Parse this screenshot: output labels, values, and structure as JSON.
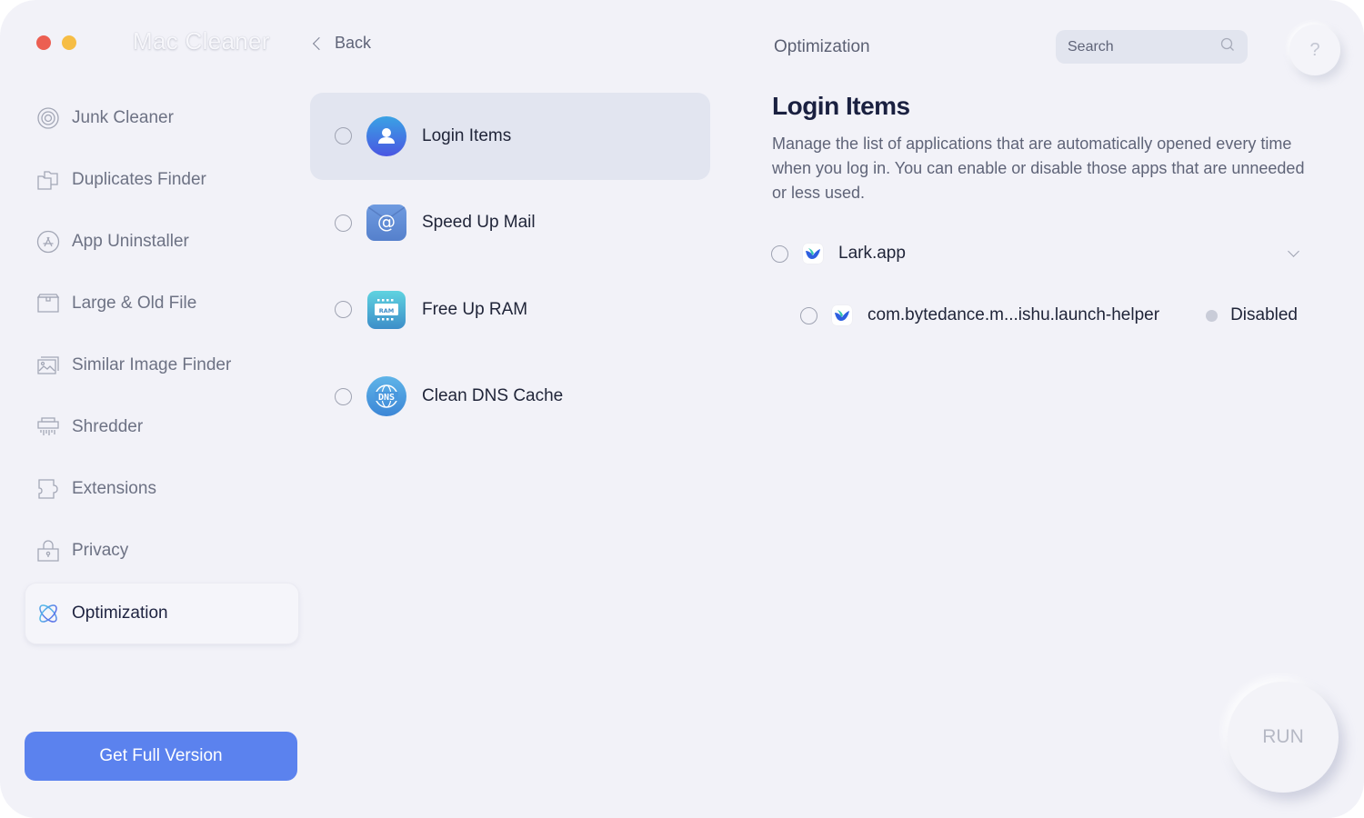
{
  "app": {
    "title": "Mac Cleaner",
    "back_label": "Back"
  },
  "sidebar": {
    "items": [
      {
        "label": "Junk Cleaner",
        "icon": "target-icon"
      },
      {
        "label": "Duplicates Finder",
        "icon": "duplicate-folders-icon"
      },
      {
        "label": "App Uninstaller",
        "icon": "app-store-icon"
      },
      {
        "label": "Large & Old File",
        "icon": "box-icon"
      },
      {
        "label": "Similar Image Finder",
        "icon": "image-icon"
      },
      {
        "label": "Shredder",
        "icon": "shredder-icon"
      },
      {
        "label": "Extensions",
        "icon": "puzzle-icon"
      },
      {
        "label": "Privacy",
        "icon": "lock-icon"
      },
      {
        "label": "Optimization",
        "icon": "atom-icon",
        "active": true
      }
    ],
    "get_full_version": "Get Full Version"
  },
  "tools": {
    "items": [
      {
        "label": "Login Items",
        "icon": "user-icon",
        "selected": true
      },
      {
        "label": "Speed Up Mail",
        "icon": "mail-icon",
        "selected": false
      },
      {
        "label": "Free Up RAM",
        "icon": "ram-icon",
        "selected": false,
        "icon_text": "RAM"
      },
      {
        "label": "Clean DNS Cache",
        "icon": "dns-icon",
        "selected": false,
        "icon_text": "DNS"
      }
    ]
  },
  "header": {
    "section": "Optimization",
    "search_placeholder": "Search",
    "help_label": "?"
  },
  "detail": {
    "title": "Login Items",
    "description": "Manage the list of applications that are automatically opened every time when you log in. You can enable or disable those apps that are unneeded or less used.",
    "apps": [
      {
        "name": "Lark.app",
        "expanded": true,
        "children": [
          {
            "name": "com.bytedance.m...ishu.launch-helper",
            "status": "Disabled"
          }
        ]
      }
    ]
  },
  "run_label": "RUN",
  "colors": {
    "accent": "#5b82ee",
    "background": "#f2f2f8",
    "selected_row": "#e2e5f0",
    "close": "#ec5f52",
    "minimize": "#f6bd45"
  }
}
